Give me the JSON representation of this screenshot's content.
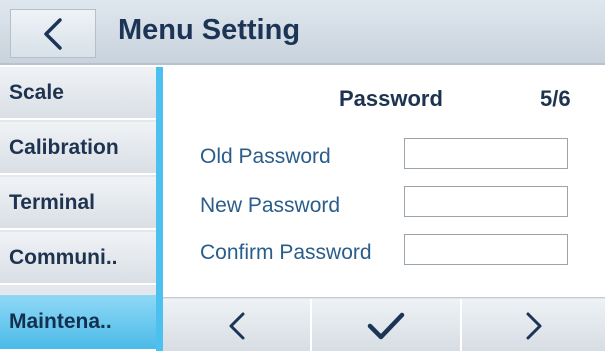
{
  "header": {
    "title": "Menu Setting",
    "back_icon": "chevron-left-icon"
  },
  "sidebar": {
    "items": [
      {
        "label": "Scale"
      },
      {
        "label": "Calibration"
      },
      {
        "label": "Terminal"
      },
      {
        "label": "Communi.."
      },
      {
        "label": "Maintena..",
        "active": true
      }
    ]
  },
  "panel": {
    "title": "Password",
    "page": "5/6",
    "fields": [
      {
        "label": "Old Password",
        "value": ""
      },
      {
        "label": "New Password",
        "value": ""
      },
      {
        "label": "Confirm Password",
        "value": ""
      }
    ]
  },
  "bottom_bar": {
    "prev_icon": "chevron-left-icon",
    "confirm_icon": "checkmark-icon",
    "next_icon": "chevron-right-icon"
  },
  "colors": {
    "accent": "#4cc1ef",
    "title_text": "#1c3455",
    "field_label_text": "#2a5d8a"
  }
}
